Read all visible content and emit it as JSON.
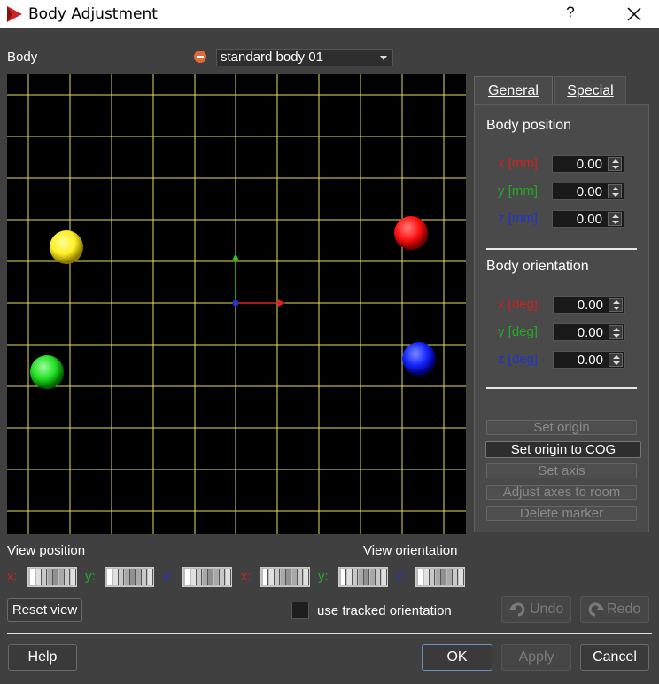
{
  "window": {
    "title": "Body Adjustment",
    "help_glyph": "?",
    "colors": {
      "titlebar": "#ffffff",
      "body": "#404040",
      "icon": "#cc2222"
    }
  },
  "body_selector": {
    "label": "Body",
    "selected": "standard body 01"
  },
  "tabs": [
    {
      "label": "General",
      "active": true
    },
    {
      "label": "Special",
      "active": false
    }
  ],
  "general": {
    "position": {
      "title": "Body position",
      "fields": [
        {
          "label": "x [mm]",
          "value": "0.00",
          "color": "#cc2222"
        },
        {
          "label": "y [mm]",
          "value": "0.00",
          "color": "#22aa22"
        },
        {
          "label": "z [mm]",
          "value": "0.00",
          "color": "#2233cc"
        }
      ]
    },
    "orientation": {
      "title": "Body orientation",
      "fields": [
        {
          "label": "x [deg]",
          "value": "0.00",
          "color": "#cc2222"
        },
        {
          "label": "y [deg]",
          "value": "0.00",
          "color": "#22aa22"
        },
        {
          "label": "z [deg]",
          "value": "0.00",
          "color": "#2233cc"
        }
      ]
    },
    "buttons": [
      {
        "label": "Set origin",
        "enabled": false
      },
      {
        "label": "Set origin to COG",
        "enabled": true
      },
      {
        "label": "Set axis",
        "enabled": false
      },
      {
        "label": "Adjust axes to room",
        "enabled": false
      },
      {
        "label": "Delete marker",
        "enabled": false
      }
    ]
  },
  "viewport": {
    "markers": [
      {
        "name": "yellow-marker",
        "color": "#ffee22"
      },
      {
        "name": "red-marker",
        "color": "#ff1111"
      },
      {
        "name": "green-marker",
        "color": "#22dd22"
      },
      {
        "name": "blue-marker",
        "color": "#1122ff"
      }
    ],
    "grid_color": "#e6e05a"
  },
  "view_controls": {
    "position_label": "View position",
    "orientation_label": "View orientation",
    "axes": [
      {
        "label": "x:",
        "color": "#cc2222"
      },
      {
        "label": "y:",
        "color": "#22aa22"
      },
      {
        "label": "z:",
        "color": "#2233cc"
      }
    ]
  },
  "reset_view": "Reset view",
  "tracked": {
    "label": "use tracked orientation",
    "checked": false
  },
  "undo": "Undo",
  "redo": "Redo",
  "footer": {
    "help": "Help",
    "ok": "OK",
    "apply": "Apply",
    "cancel": "Cancel"
  }
}
